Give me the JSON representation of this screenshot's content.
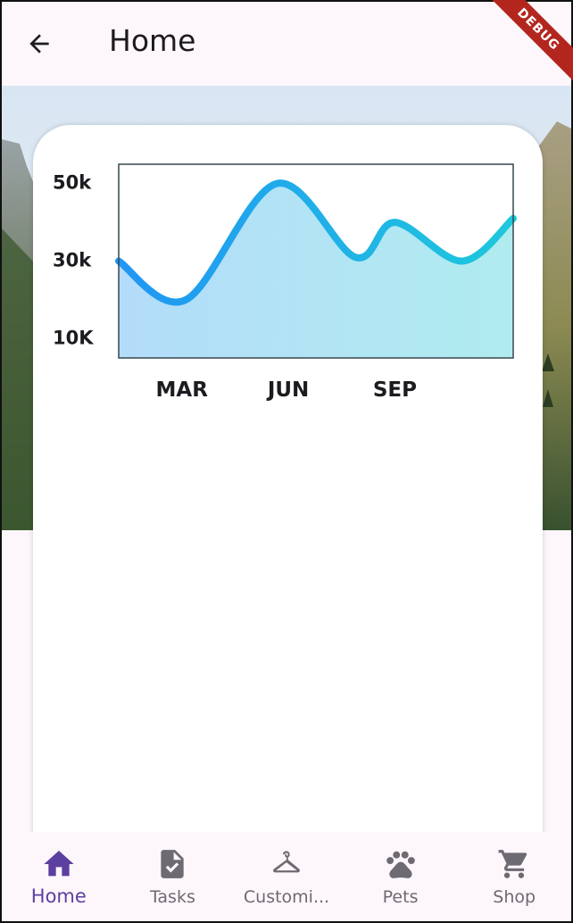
{
  "appbar": {
    "title": "Home",
    "debug_label": "DEBUG"
  },
  "chart_data": {
    "type": "area",
    "x_ticks": [
      "MAR",
      "JUN",
      "SEP"
    ],
    "y_ticks": [
      "50k",
      "30k",
      "10K"
    ],
    "points": [
      {
        "x": 1.0,
        "y": 30
      },
      {
        "x": 2.7,
        "y": 20
      },
      {
        "x": 5.0,
        "y": 50
      },
      {
        "x": 7.0,
        "y": 31
      },
      {
        "x": 8.0,
        "y": 40
      },
      {
        "x": 9.7,
        "y": 30
      },
      {
        "x": 11.0,
        "y": 41
      }
    ],
    "xlim": [
      1,
      11
    ],
    "ylim": [
      5,
      55
    ],
    "colors": {
      "line_start": "#2196f3",
      "line_end": "#1ec8dc",
      "fill_start": "#b3dcfa",
      "fill_end": "#b0ecef"
    }
  },
  "bottom_nav": {
    "items": [
      {
        "label": "Home",
        "icon": "home-icon",
        "active": true
      },
      {
        "label": "Tasks",
        "icon": "task-file-icon",
        "active": false
      },
      {
        "label": "Customi...",
        "icon": "hanger-icon",
        "active": false
      },
      {
        "label": "Pets",
        "icon": "paw-icon",
        "active": false
      },
      {
        "label": "Shop",
        "icon": "cart-icon",
        "active": false
      }
    ],
    "active_color": "#5d3fa0",
    "inactive_color": "#6d6a72"
  }
}
